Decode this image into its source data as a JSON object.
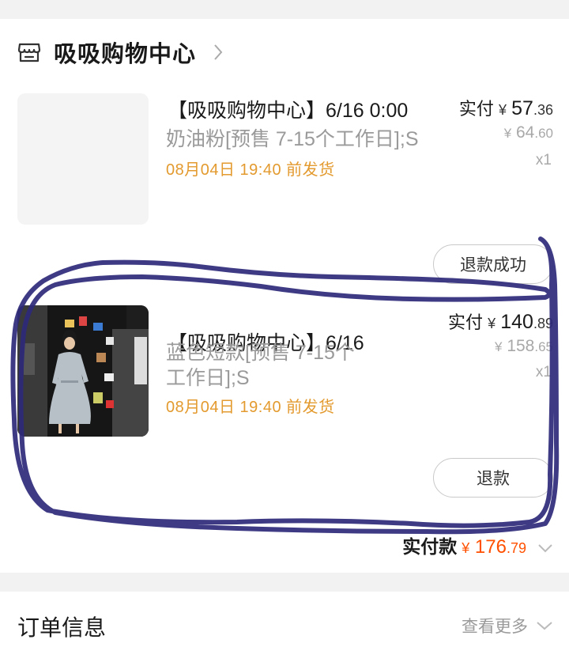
{
  "shop": {
    "name": "吸吸购物中心",
    "icon": "store-icon",
    "arrow_icon": "chevron-right-icon"
  },
  "items": [
    {
      "title": "【吸吸购物中心】6/16 0:00",
      "description": "奶油粉[预售 7-15个工作日];S",
      "ship_time": "08月04日 19:40 前发货",
      "paid_label": "实付",
      "currency": "¥",
      "paid_int": "57",
      "paid_dec": ".36",
      "orig_int": "64",
      "orig_dec": ".60",
      "qty": "x1",
      "button": "退款成功"
    },
    {
      "title": "【吸吸购物中心】6/16",
      "description": "蓝色短款[预售 7-15个工作日];S",
      "ship_time": "08月04日 19:40 前发货",
      "paid_label": "实付",
      "currency": "¥",
      "paid_int": "140",
      "paid_dec": ".89",
      "orig_int": "158",
      "orig_dec": ".65",
      "qty": "x1",
      "button": "退款"
    }
  ],
  "total": {
    "label": "实付款",
    "currency": "¥",
    "int": "176",
    "dec": ".79"
  },
  "order_info": {
    "title": "订单信息",
    "more": "查看更多"
  },
  "colors": {
    "accent": "#ff5000",
    "ship": "#e39a2e",
    "scribble": "#2e2a7a"
  }
}
